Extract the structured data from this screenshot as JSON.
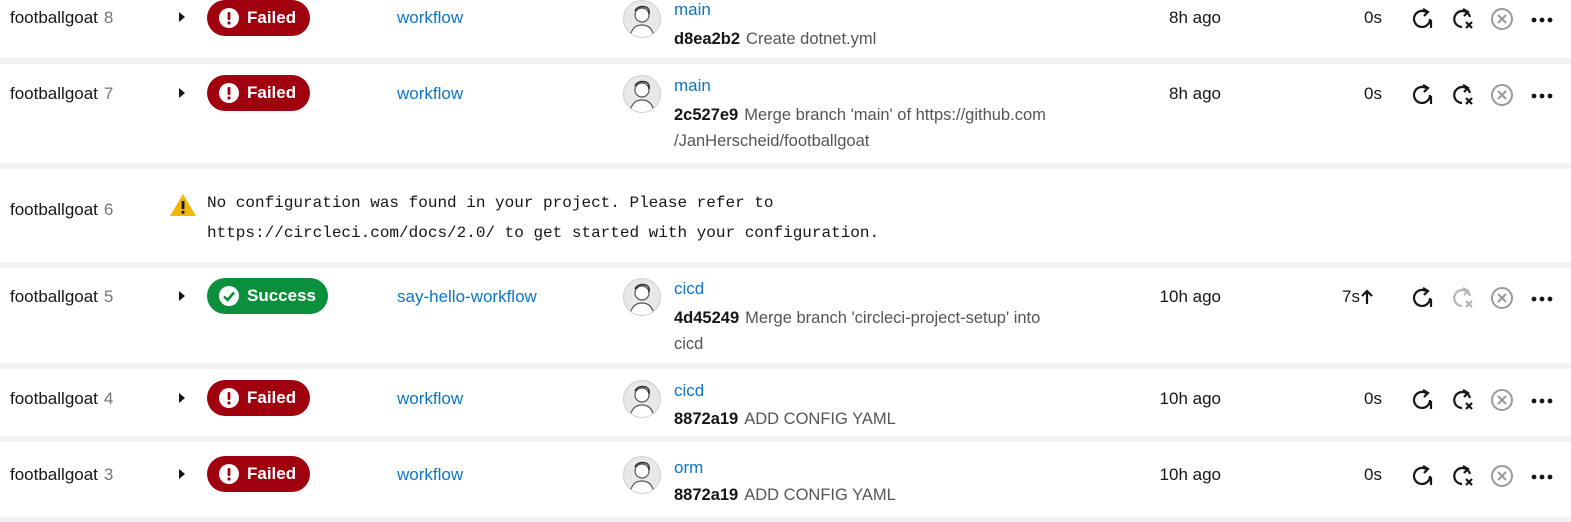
{
  "pipelines": [
    {
      "project": "footballgoat",
      "number": "8",
      "status": "Failed",
      "workflow": "workflow",
      "branch": "main",
      "sha": "d8ea2b2",
      "message_line1": "Create dotnet.yml",
      "message_line2": "",
      "time": "8h ago",
      "duration": "0s",
      "rerun_failed_enabled": true
    },
    {
      "project": "footballgoat",
      "number": "7",
      "status": "Failed",
      "workflow": "workflow",
      "branch": "main",
      "sha": "2c527e9",
      "message_line1": "Merge branch 'main' of https://github.com",
      "message_line2": "/JanHerscheid/footballgoat",
      "time": "8h ago",
      "duration": "0s",
      "rerun_failed_enabled": true
    },
    {
      "project": "footballgoat",
      "number": "6",
      "config_error": "No configuration was found in your project. Please refer to",
      "config_error_line2": "https://circleci.com/docs/2.0/ to get started with your configuration."
    },
    {
      "project": "footballgoat",
      "number": "5",
      "status": "Success",
      "workflow": "say-hello-workflow",
      "branch": "cicd",
      "sha": "4d45249",
      "message_line1": "Merge branch 'circleci-project-setup' into",
      "message_line2": "cicd",
      "time": "10h ago",
      "duration": "7s",
      "rerun_failed_enabled": false
    },
    {
      "project": "footballgoat",
      "number": "4",
      "status": "Failed",
      "workflow": "workflow",
      "branch": "cicd",
      "sha": "8872a19",
      "message_line1": "ADD CONFIG YAML",
      "message_line2": "",
      "time": "10h ago",
      "duration": "0s",
      "rerun_failed_enabled": true
    },
    {
      "project": "footballgoat",
      "number": "3",
      "status": "Failed",
      "workflow": "workflow",
      "branch": "orm",
      "sha": "8872a19",
      "message_line1": "ADD CONFIG YAML",
      "message_line2": "",
      "time": "10h ago",
      "duration": "0s",
      "rerun_failed_enabled": true
    }
  ],
  "colors": {
    "failed": "#a1000e",
    "success": "#0a8f3d",
    "link": "#0b76c9",
    "warning": "#f2b705"
  },
  "icons": [
    "caret-right-icon",
    "failed-exclamation-icon",
    "success-check-icon",
    "avatar",
    "rerun-icon",
    "rerun-failed-icon",
    "cancel-icon",
    "more-icon",
    "warning-icon",
    "arrow-up-icon"
  ]
}
